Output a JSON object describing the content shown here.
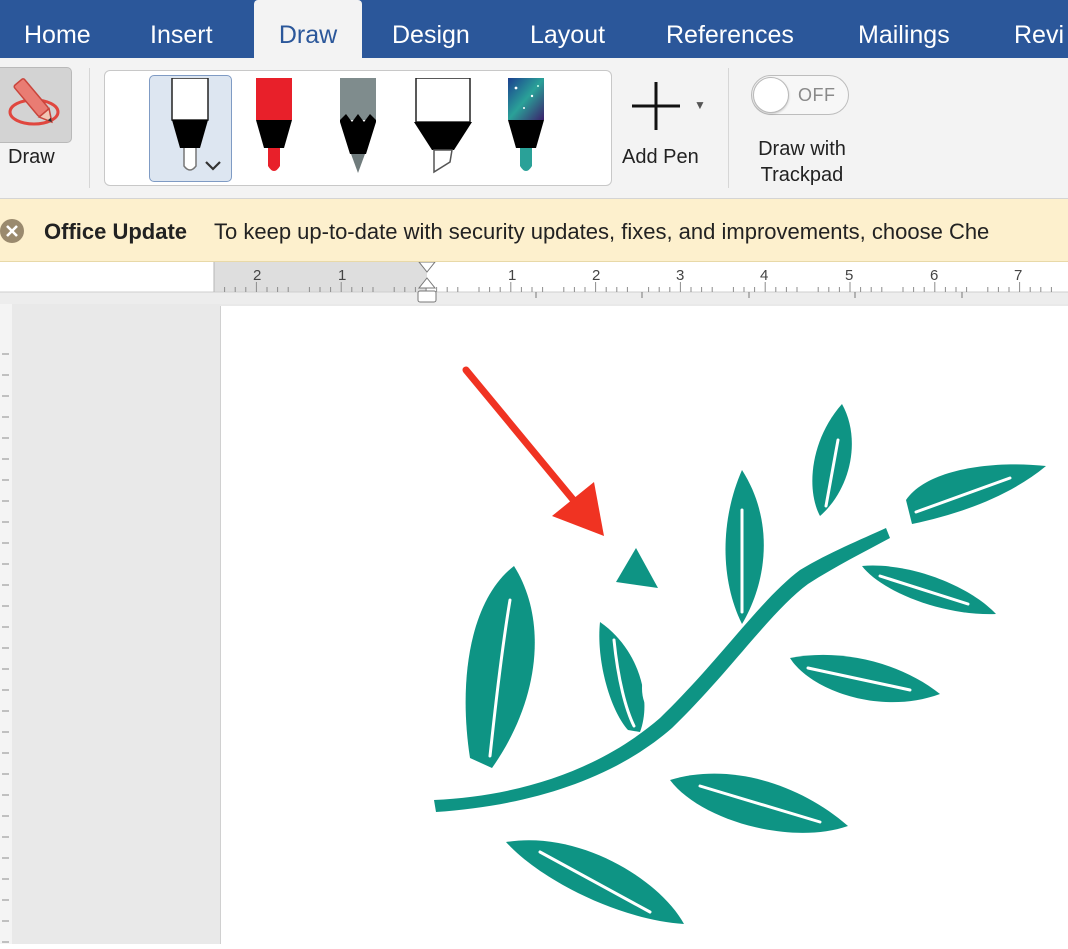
{
  "ribbon_tabs": [
    {
      "label": "Home",
      "active": false
    },
    {
      "label": "Insert",
      "active": false
    },
    {
      "label": "Draw",
      "active": true
    },
    {
      "label": "Design",
      "active": false
    },
    {
      "label": "Layout",
      "active": false
    },
    {
      "label": "References",
      "active": false
    },
    {
      "label": "Mailings",
      "active": false
    },
    {
      "label": "Revi",
      "active": false
    }
  ],
  "draw_tool": {
    "label": "Draw",
    "icon": "pencil-circle-icon"
  },
  "pens": [
    {
      "name": "pen-black",
      "icon": "pen-icon",
      "color": "#000000",
      "selected": true
    },
    {
      "name": "pen-red",
      "icon": "pen-icon",
      "color": "#e8202a",
      "selected": false
    },
    {
      "name": "pencil-gray",
      "icon": "pencil-icon",
      "color": "#7f8c8d",
      "selected": false
    },
    {
      "name": "highlighter",
      "icon": "highlighter-icon",
      "color": "#000000",
      "selected": false
    },
    {
      "name": "pen-galaxy",
      "icon": "pen-icon",
      "color": "#2aa198",
      "selected": false
    }
  ],
  "add_pen": {
    "label": "Add Pen",
    "icon": "plus-icon"
  },
  "trackpad": {
    "toggle_state": "OFF",
    "label_line1": "Draw with",
    "label_line2": "Trackpad"
  },
  "update_bar": {
    "title": "Office Update",
    "message": "To keep up-to-date with security updates, fixes, and improvements, choose Che"
  },
  "ruler": {
    "labels": [
      "2",
      "1",
      "1",
      "2",
      "3",
      "4",
      "5",
      "6",
      "7"
    ]
  },
  "colors": {
    "accent": "#2b579a",
    "leaf": "#0e9484",
    "arrow": "#f03322",
    "update_bg": "#fdf0cd"
  }
}
